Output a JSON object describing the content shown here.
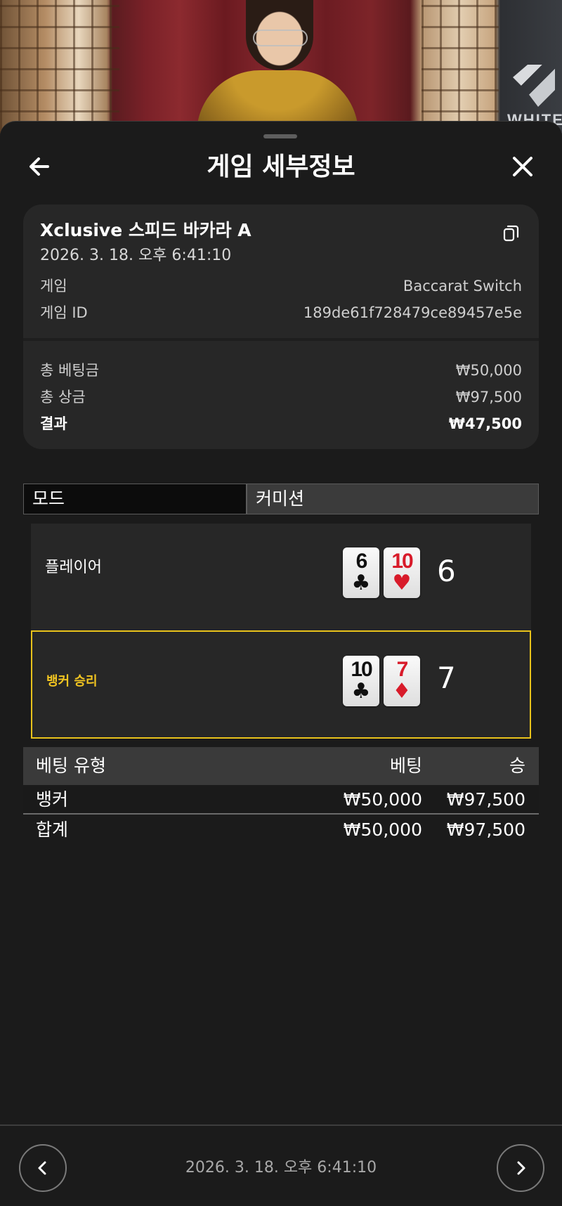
{
  "header": {
    "title": "게임 세부정보"
  },
  "summary": {
    "table_name": "Xclusive 스피드 바카라 A",
    "datetime": "2026. 3. 18. 오후 6:41:10",
    "game_label": "게임",
    "game_value": "Baccarat Switch",
    "game_id_label": "게임 ID",
    "game_id_value": "189de61f728479ce89457e5e",
    "total_bet_label": "총 베팅금",
    "total_bet_value": "₩50,000",
    "total_win_label": "총 상금",
    "total_win_value": "₩97,500",
    "result_label": "결과",
    "result_value": "₩47,500"
  },
  "mode": {
    "label": "모드",
    "value": "커미션"
  },
  "hands": {
    "player": {
      "label": "플레이어",
      "score": "6",
      "cards": [
        {
          "rank": "6",
          "suit": "♣",
          "color": "#111111"
        },
        {
          "rank": "10",
          "suit": "♥",
          "color": "#d81b2a"
        }
      ]
    },
    "banker": {
      "label": "뱅커 승리",
      "score": "7",
      "cards": [
        {
          "rank": "10",
          "suit": "♣",
          "color": "#111111"
        },
        {
          "rank": "7",
          "suit": "♦",
          "color": "#d81b2a"
        }
      ]
    }
  },
  "bets": {
    "headers": [
      "베팅 유형",
      "베팅",
      "승"
    ],
    "rows": [
      {
        "type": "뱅커",
        "bet": "₩50,000",
        "win": "₩97,500"
      }
    ],
    "total": {
      "label": "합계",
      "bet": "₩50,000",
      "win": "₩97,500"
    }
  },
  "footer": {
    "datetime": "2026. 3. 18. 오후 6:41:10"
  },
  "icons": {
    "back": "arrow-left-icon",
    "close": "close-icon",
    "copy": "copy-icon",
    "prev": "chevron-left-icon",
    "next": "chevron-right-icon"
  },
  "colors": {
    "accent": "#e8c21b",
    "banker_label": "#f2c521",
    "card_red": "#d81b2a",
    "background": "#1b1b1b",
    "card_bg": "#272727"
  }
}
